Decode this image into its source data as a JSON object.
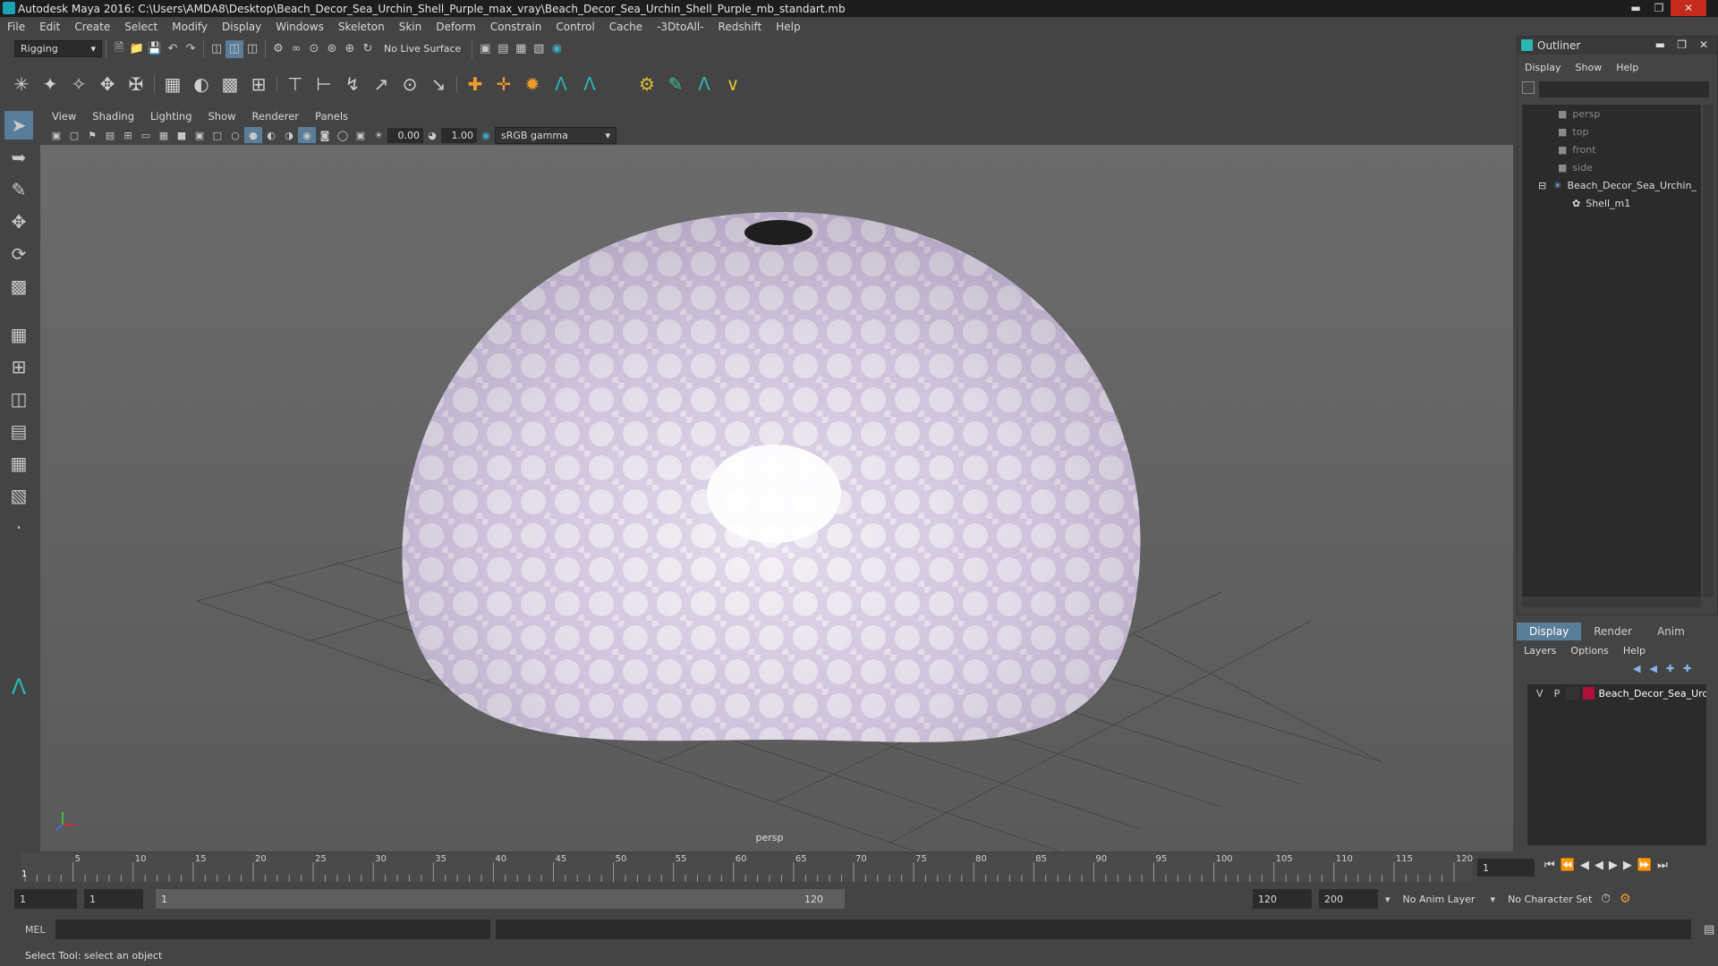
{
  "window": {
    "title": "Autodesk Maya 2016: C:\\Users\\AMDA8\\Desktop\\Beach_Decor_Sea_Urchin_Shell_Purple_max_vray\\Beach_Decor_Sea_Urchin_Shell_Purple_mb_standart.mb",
    "minimize_icon": "minimize-icon",
    "restore_icon": "restore-icon",
    "close_icon": "close-icon"
  },
  "menubar": [
    "File",
    "Edit",
    "Create",
    "Select",
    "Modify",
    "Display",
    "Windows",
    "Skeleton",
    "Skin",
    "Deform",
    "Constrain",
    "Control",
    "Cache",
    "-3DtoAll-",
    "Redshift",
    "Help"
  ],
  "shelf": {
    "mode": "Rigging",
    "live_surface": "No Live Surface"
  },
  "viewport": {
    "menu": [
      "View",
      "Shading",
      "Lighting",
      "Show",
      "Renderer",
      "Panels"
    ],
    "exposure": "0.00",
    "gamma": "1.00",
    "color_space": "sRGB gamma",
    "camera_label": "persp"
  },
  "outliner": {
    "title": "Outliner",
    "menu": [
      "Display",
      "Show",
      "Help"
    ],
    "items": [
      {
        "label": "persp",
        "kind": "camera"
      },
      {
        "label": "top",
        "kind": "camera"
      },
      {
        "label": "front",
        "kind": "camera"
      },
      {
        "label": "side",
        "kind": "camera"
      },
      {
        "label": "Beach_Decor_Sea_Urchin_",
        "kind": "group"
      },
      {
        "label": "Shell_m1",
        "kind": "mesh"
      }
    ]
  },
  "layers": {
    "tabs": [
      "Display",
      "Render",
      "Anim"
    ],
    "active_tab": "Display",
    "menu": [
      "Layers",
      "Options",
      "Help"
    ],
    "row": {
      "v": "V",
      "p": "P",
      "name": "Beach_Decor_Sea_Urcl",
      "color": "#b0103a"
    }
  },
  "timeline": {
    "ticks": [
      "5",
      "10",
      "15",
      "20",
      "25",
      "30",
      "35",
      "40",
      "45",
      "50",
      "55",
      "60",
      "65",
      "70",
      "75",
      "80",
      "85",
      "90",
      "95",
      "100",
      "105",
      "110",
      "115",
      "120"
    ],
    "start_marker": "1",
    "current_frame": "1"
  },
  "range": {
    "start": "1",
    "start2": "1",
    "slider_start": "1",
    "slider_end": "120",
    "end": "120",
    "max": "200",
    "anim_layer": "No Anim Layer",
    "character_set": "No Character Set"
  },
  "command": {
    "lang": "MEL"
  },
  "helpline": "Select Tool: select an object"
}
